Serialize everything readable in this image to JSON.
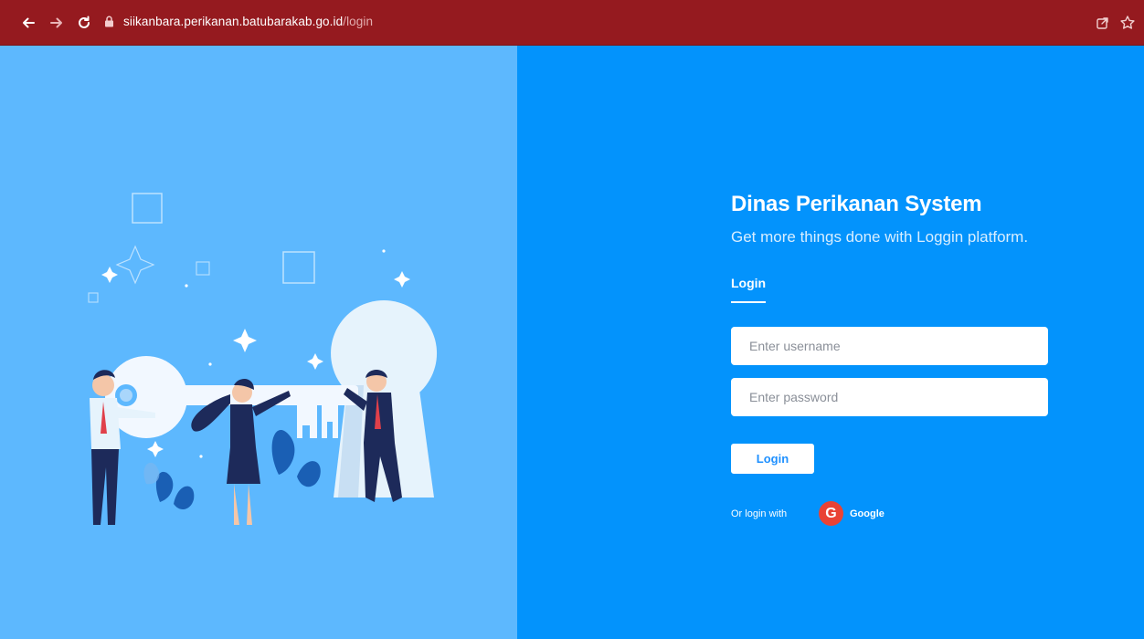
{
  "browser": {
    "url_host": "siikanbara.perikanan.batubarakab.go.id",
    "url_path": "/login",
    "icons": [
      "back-arrow-icon",
      "forward-arrow-icon",
      "reload-icon",
      "lock-icon",
      "share-icon",
      "star-icon"
    ]
  },
  "login": {
    "title": "Dinas Perikanan System",
    "subtitle": "Get more things done with Loggin platform.",
    "tab_label": "Login",
    "username_placeholder": "Enter username",
    "password_placeholder": "Enter password",
    "button_label": "Login",
    "or_text": "Or login with",
    "google_letter": "G",
    "google_label": "Google"
  },
  "colors": {
    "chrome": "#951a1f",
    "left_panel": "#5db8fe",
    "right_panel": "#0393fc",
    "google": "#e94335"
  }
}
